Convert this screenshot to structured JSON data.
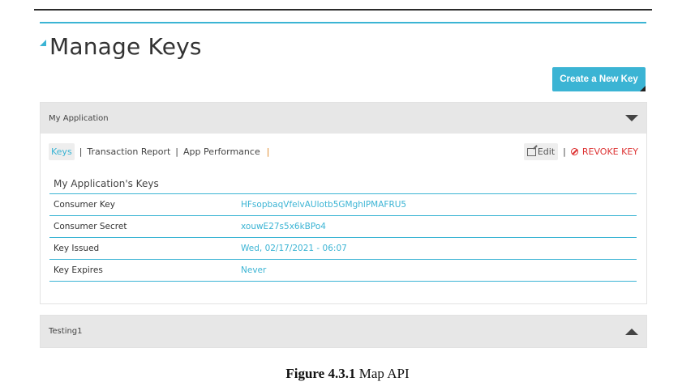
{
  "page": {
    "title": "Manage Keys",
    "create_button": "Create a New Key"
  },
  "app_panel": {
    "name": "My Application",
    "tabs": [
      {
        "label": "Keys"
      },
      {
        "label": "Transaction Report"
      },
      {
        "label": "App Performance"
      }
    ],
    "edit_label": "Edit",
    "revoke_label": "REVOKE KEY",
    "keys_heading": "My Application's Keys",
    "rows": [
      {
        "label": "Consumer Key",
        "value": "HFsopbaqVfelvAUlotb5GMghlPMAFRU5"
      },
      {
        "label": "Consumer Secret",
        "value": "xouwE27s5x6kBPo4"
      },
      {
        "label": "Key Issued",
        "value": "Wed, 02/17/2021 - 06:07"
      },
      {
        "label": "Key Expires",
        "value": "Never"
      }
    ]
  },
  "testing_panel": {
    "name": "Testing1"
  },
  "caption": {
    "bold": "Figure 4.3.1",
    "text": "Map API"
  },
  "colors": {
    "accent": "#3bb4d4",
    "revoke": "#dd3333",
    "panel_header": "#e7e7e7"
  }
}
